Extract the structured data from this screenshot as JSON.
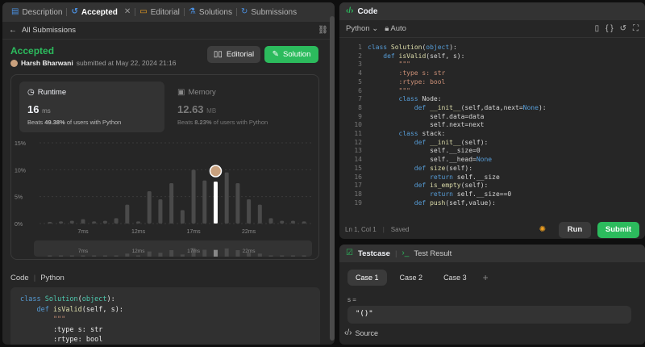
{
  "left_tabs": [
    {
      "icon": "document-icon",
      "label": "Description"
    },
    {
      "icon": "history-icon",
      "label": "Accepted"
    },
    {
      "icon": "book-icon",
      "label": "Editorial"
    },
    {
      "icon": "flask-icon",
      "label": "Solutions"
    },
    {
      "icon": "clock-icon",
      "label": "Submissions"
    }
  ],
  "back_label": "All Submissions",
  "submission": {
    "status": "Accepted",
    "author": "Harsh Bharwani",
    "submitted_text": "submitted at May 22, 2024 21:16"
  },
  "buttons": {
    "editorial": "Editorial",
    "solution": "Solution"
  },
  "runtime": {
    "label": "Runtime",
    "value": "16",
    "unit": "ms",
    "beats_prefix": "Beats",
    "beats_pct": "49.38%",
    "beats_suffix": "of users with Python"
  },
  "memory": {
    "label": "Memory",
    "value": "12.63",
    "unit": "MB",
    "beats_prefix": "Beats",
    "beats_pct": "8.23%",
    "beats_suffix": "of users with Python"
  },
  "chart_data": {
    "type": "bar",
    "ylabel_ticks": [
      "15%",
      "10%",
      "5%",
      "0%"
    ],
    "ylim": [
      0,
      15
    ],
    "xtick_labels": [
      "7ms",
      "12ms",
      "17ms",
      "22ms"
    ],
    "grid": true,
    "values": [
      0.3,
      0.4,
      0.5,
      0.8,
      0.4,
      0.5,
      1.0,
      3.5,
      0.4,
      6.0,
      4.5,
      7.5,
      2.5,
      10.0,
      8.0,
      7.8,
      9.5,
      7.5,
      4.5,
      3.5,
      1.0,
      0.5,
      0.5,
      0.4
    ],
    "highlight_index": 15,
    "highlight_color": "#ffffff",
    "bar_color": "#4a4a4a"
  },
  "code_section": {
    "title": "Code",
    "language": "Python"
  },
  "code_preview": [
    "class Solution(object):",
    "    def isValid(self, s):",
    "        \"\"\"",
    "        :type s: str",
    "        :rtype: bool"
  ],
  "editor": {
    "title": "Code",
    "language": "Python",
    "mode": "Auto",
    "lines": [
      "class Solution(object):",
      "    def isValid(self, s):",
      "        \"\"\"",
      "        :type s: str",
      "        :rtype: bool",
      "        \"\"\"",
      "        class Node:",
      "            def __init__(self,data,next=None):",
      "                self.data=data",
      "                self.next=next",
      "        class stack:",
      "            def __init__(self):",
      "                self.__size=0",
      "                self.__head=None",
      "            def size(self):",
      "                return self.__size",
      "            def is_empty(self):",
      "                return self.__size==0",
      "            def push(self,value):"
    ],
    "cursor": "Ln 1, Col 1",
    "saved": "Saved",
    "run": "Run",
    "submit": "Submit"
  },
  "testcase": {
    "tab1": "Testcase",
    "tab2": "Test Result",
    "cases": [
      "Case 1",
      "Case 2",
      "Case 3"
    ],
    "var_label": "s =",
    "value": "\"()\"",
    "source": "Source"
  },
  "colors": {
    "accent_green": "#2cbb5d",
    "panel": "#262626",
    "background": "#0f0f0f"
  }
}
